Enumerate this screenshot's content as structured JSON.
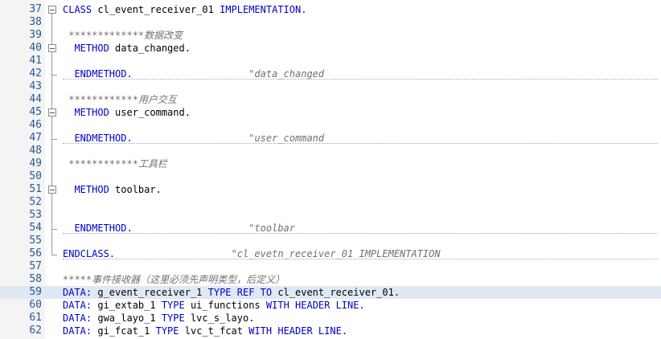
{
  "editor": {
    "lines": [
      {
        "num": "37",
        "fold": "box",
        "segments": [
          {
            "t": "CLASS",
            "c": "kw"
          },
          {
            "t": " cl_event_receiver_01 ",
            "c": "id"
          },
          {
            "t": "IMPLEMENTATION.",
            "c": "kw"
          }
        ]
      },
      {
        "num": "38",
        "segments": []
      },
      {
        "num": "39",
        "segments": [
          {
            "t": " *************数据改变",
            "c": "cm"
          }
        ]
      },
      {
        "num": "40",
        "fold": "box",
        "segments": [
          {
            "t": "  METHOD",
            "c": "kw"
          },
          {
            "t": " data_changed.",
            "c": "id"
          }
        ]
      },
      {
        "num": "41",
        "segments": []
      },
      {
        "num": "42",
        "fold": "end",
        "sep": true,
        "segments": [
          {
            "t": "  ENDMETHOD.",
            "c": "kw"
          },
          {
            "t": "                    \"data_changed",
            "c": "cm"
          }
        ]
      },
      {
        "num": "43",
        "segments": []
      },
      {
        "num": "44",
        "segments": [
          {
            "t": " ************用户交互",
            "c": "cm"
          }
        ]
      },
      {
        "num": "45",
        "fold": "box",
        "segments": [
          {
            "t": "  METHOD",
            "c": "kw"
          },
          {
            "t": " user_command.",
            "c": "id"
          }
        ]
      },
      {
        "num": "46",
        "segments": []
      },
      {
        "num": "47",
        "fold": "end",
        "sep": true,
        "segments": [
          {
            "t": "  ENDMETHOD.",
            "c": "kw"
          },
          {
            "t": "                    \"user_command",
            "c": "cm"
          }
        ]
      },
      {
        "num": "48",
        "segments": []
      },
      {
        "num": "49",
        "segments": [
          {
            "t": " ************工具栏",
            "c": "cm"
          }
        ]
      },
      {
        "num": "50",
        "segments": []
      },
      {
        "num": "51",
        "fold": "box",
        "segments": [
          {
            "t": "  METHOD",
            "c": "kw"
          },
          {
            "t": " toolbar.",
            "c": "id"
          }
        ]
      },
      {
        "num": "52",
        "segments": []
      },
      {
        "num": "53",
        "segments": []
      },
      {
        "num": "54",
        "fold": "end",
        "sep": true,
        "segments": [
          {
            "t": "  ENDMETHOD.",
            "c": "kw"
          },
          {
            "t": "                    \"toolbar",
            "c": "cm"
          }
        ]
      },
      {
        "num": "55",
        "segments": []
      },
      {
        "num": "56",
        "fold": "end",
        "sep": true,
        "segments": [
          {
            "t": "ENDCLASS.",
            "c": "kw"
          },
          {
            "t": "                    \"cl_evetn_receiver_01 IMPLEMENTATION",
            "c": "cm"
          }
        ]
      },
      {
        "num": "57",
        "segments": []
      },
      {
        "num": "58",
        "segments": [
          {
            "t": "*****事件接收器（这里必须先声明类型，后定义）",
            "c": "cm"
          }
        ]
      },
      {
        "num": "59",
        "hl": true,
        "segments": [
          {
            "t": "DATA:",
            "c": "kw"
          },
          {
            "t": " g_event_receiver_1 ",
            "c": "id"
          },
          {
            "t": "TYPE REF TO",
            "c": "kw"
          },
          {
            "t": " cl_event_receiver_01.",
            "c": "id"
          }
        ]
      },
      {
        "num": "60",
        "segments": [
          {
            "t": "DATA:",
            "c": "kw"
          },
          {
            "t": " gi_extab_1 ",
            "c": "id"
          },
          {
            "t": "TYPE",
            "c": "kw"
          },
          {
            "t": " ui_functions ",
            "c": "id"
          },
          {
            "t": "WITH HEADER LINE.",
            "c": "kw"
          }
        ]
      },
      {
        "num": "61",
        "segments": [
          {
            "t": "DATA:",
            "c": "kw"
          },
          {
            "t": " gwa_layo_1 ",
            "c": "id"
          },
          {
            "t": "TYPE",
            "c": "kw"
          },
          {
            "t": " lvc_s_layo.",
            "c": "id"
          }
        ]
      },
      {
        "num": "62",
        "segments": [
          {
            "t": "DATA:",
            "c": "kw"
          },
          {
            "t": " gi_fcat_1 ",
            "c": "id"
          },
          {
            "t": "TYPE",
            "c": "kw"
          },
          {
            "t": " lvc_t_fcat ",
            "c": "id"
          },
          {
            "t": "WITH HEADER LINE.",
            "c": "kw"
          }
        ]
      }
    ]
  }
}
